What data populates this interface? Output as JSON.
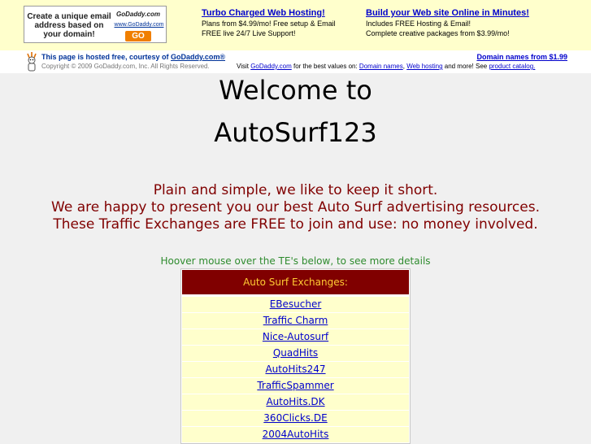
{
  "ad_banner": {
    "text": "Create a unique email address based on your domain!",
    "logo": "GoDaddy.com",
    "url": "www.GoDaddy.com",
    "go_label": "GO"
  },
  "ads": [
    {
      "title": "Turbo Charged Web Hosting!",
      "line1": "Plans from $4.99/mo! Free setup & Email",
      "line2": "FREE live 24/7 Live Support!"
    },
    {
      "title": "Build your Web site Online in Minutes!",
      "line1": "Includes FREE Hosting & Email!",
      "line2": "Complete creative packages from $3.99/mo!"
    }
  ],
  "hosting": {
    "prefix": "This page is hosted free, courtesy of ",
    "link": "GoDaddy.com®",
    "copyright": "Copyright © 2009 GoDaddy.com, Inc. All Rights Reserved.",
    "domain_offer": "Domain names from $1.99",
    "visit_prefix": "Visit ",
    "visit_link": "GoDaddy.com",
    "visit_mid": " for the best values on: ",
    "link_domains": "Domain names",
    "comma": ", ",
    "link_hosting": "Web hosting",
    "more": " and more! See ",
    "link_catalog": "product catalog."
  },
  "page": {
    "title_line1": "Welcome to",
    "title_line2": "AutoSurf123",
    "intro_line1": "Plain and simple, we like to keep it short.",
    "intro_line2": "We are happy to present you our best Auto Surf advertising resources.",
    "intro_line3": "These Traffic Exchanges are FREE to join and use: no money involved.",
    "hover_note": "Hoover mouse over the TE's below, to see more details"
  },
  "exchanges": {
    "header": "Auto Surf Exchanges:",
    "items": [
      "EBesucher",
      "Traffic Charm",
      "Nice-Autosurf",
      "QuadHits",
      "AutoHits247",
      "TrafficSpammer",
      "AutoHits.DK",
      "360Clicks.DE",
      "2004AutoHits"
    ]
  }
}
